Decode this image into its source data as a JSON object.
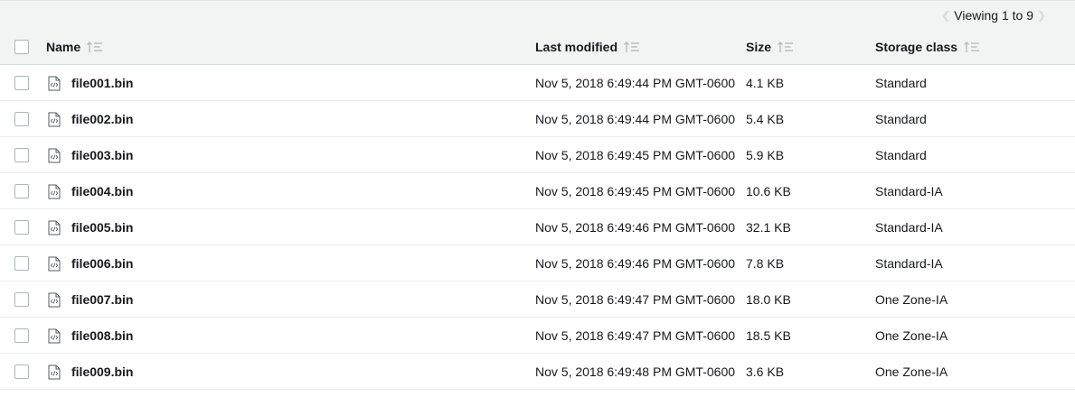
{
  "pager": {
    "text": "Viewing 1 to 9",
    "prev_icon": "chevron-left-icon",
    "next_icon": "chevron-right-icon"
  },
  "columns": {
    "name": "Name",
    "last_modified": "Last modified",
    "size": "Size",
    "storage_class": "Storage class"
  },
  "rows": [
    {
      "name": "file001.bin",
      "modified": "Nov 5, 2018 6:49:44 PM GMT-0600",
      "size": "4.1 KB",
      "class": "Standard"
    },
    {
      "name": "file002.bin",
      "modified": "Nov 5, 2018 6:49:44 PM GMT-0600",
      "size": "5.4 KB",
      "class": "Standard"
    },
    {
      "name": "file003.bin",
      "modified": "Nov 5, 2018 6:49:45 PM GMT-0600",
      "size": "5.9 KB",
      "class": "Standard"
    },
    {
      "name": "file004.bin",
      "modified": "Nov 5, 2018 6:49:45 PM GMT-0600",
      "size": "10.6 KB",
      "class": "Standard-IA"
    },
    {
      "name": "file005.bin",
      "modified": "Nov 5, 2018 6:49:46 PM GMT-0600",
      "size": "32.1 KB",
      "class": "Standard-IA"
    },
    {
      "name": "file006.bin",
      "modified": "Nov 5, 2018 6:49:46 PM GMT-0600",
      "size": "7.8 KB",
      "class": "Standard-IA"
    },
    {
      "name": "file007.bin",
      "modified": "Nov 5, 2018 6:49:47 PM GMT-0600",
      "size": "18.0 KB",
      "class": "One Zone-IA"
    },
    {
      "name": "file008.bin",
      "modified": "Nov 5, 2018 6:49:47 PM GMT-0600",
      "size": "18.5 KB",
      "class": "One Zone-IA"
    },
    {
      "name": "file009.bin",
      "modified": "Nov 5, 2018 6:49:48 PM GMT-0600",
      "size": "3.6 KB",
      "class": "One Zone-IA"
    }
  ]
}
